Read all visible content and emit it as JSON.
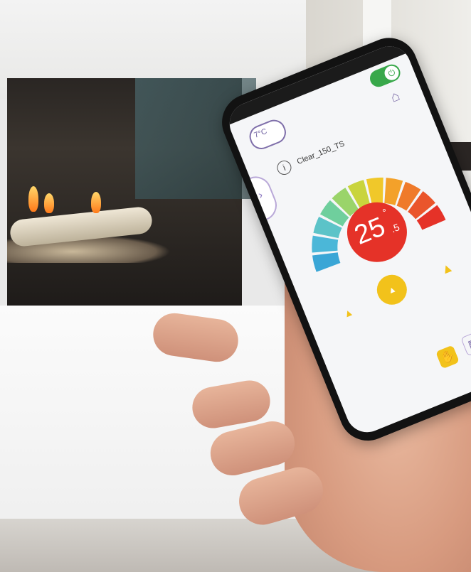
{
  "app": {
    "weather_temp": "7°C",
    "device_name": "Clear_150_TS",
    "temperature": {
      "whole": "25",
      "degree": "°",
      "decimal": ".5"
    }
  },
  "icons": {
    "power": "power-icon",
    "weather": "cloud-sun-icon",
    "home": "home-icon",
    "info": "info-icon",
    "side_arrow": "chevron-right-icon",
    "flame_small_left": "flame-icon",
    "flame_small_right": "flame-icon",
    "flame_center": "flame-up-icon",
    "mode_hand": "hand-icon",
    "mode_schedule": "schedule-icon"
  },
  "colors": {
    "accent_green": "#38a84a",
    "temp_red": "#e53228",
    "flame_yellow": "#f2c21b",
    "purple": "#7f6faa",
    "dial_segments": [
      "#3aa6d6",
      "#4bb7d8",
      "#5cc3c8",
      "#6fcf9d",
      "#9ad46a",
      "#c9d43d",
      "#f0c82a",
      "#f3a12a",
      "#ef7a2a",
      "#ea552c",
      "#e53228"
    ]
  }
}
